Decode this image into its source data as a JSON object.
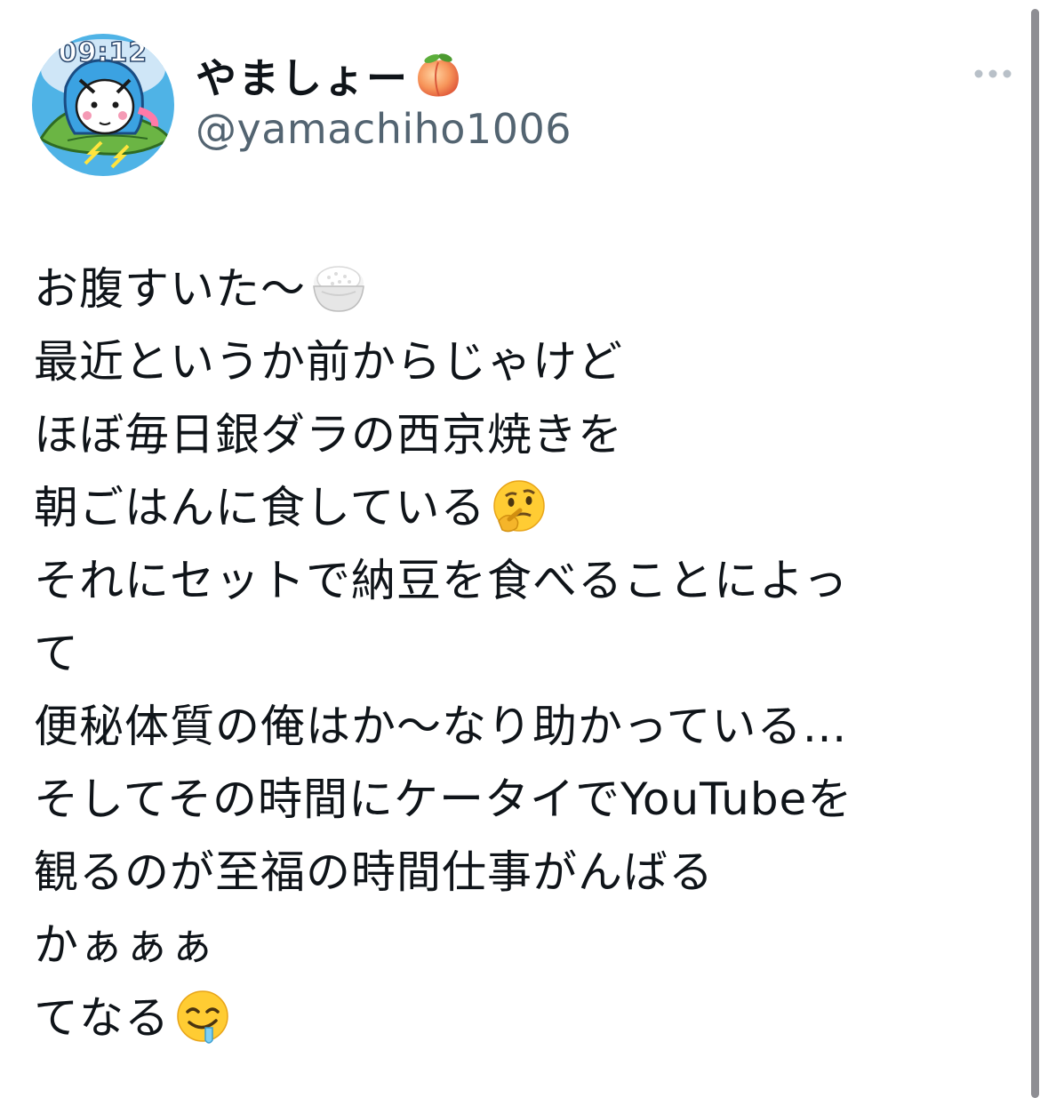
{
  "avatar": {
    "overlay_time": "09:12",
    "icon": "user-avatar"
  },
  "user": {
    "display_name": "やましょー",
    "display_name_emoji": "peach-icon",
    "handle": "@yamachiho1006"
  },
  "menu": {
    "more_icon": "ellipsis-horizontal-icon"
  },
  "tweet": {
    "lines": [
      "お腹すいた〜",
      "最近というか前からじゃけど",
      "ほぼ毎日銀ダラの西京焼きを",
      "朝ごはんに食している",
      "それにセットで納豆を食べることによっ",
      "て",
      "便秘体質の俺はか〜なり助かっている…",
      "そしてその時間にケータイでYouTubeを",
      "観るのが至福の時間仕事がんばる",
      "かぁぁぁ",
      "てなる"
    ],
    "emojis": {
      "line_0": "rice-bowl-icon",
      "line_3": "thinking-face-icon",
      "line_10": "drooling-face-icon"
    }
  },
  "colors": {
    "text_primary": "#0f1419",
    "text_secondary": "#536471",
    "avatar_bg": "#4fb3e6"
  }
}
